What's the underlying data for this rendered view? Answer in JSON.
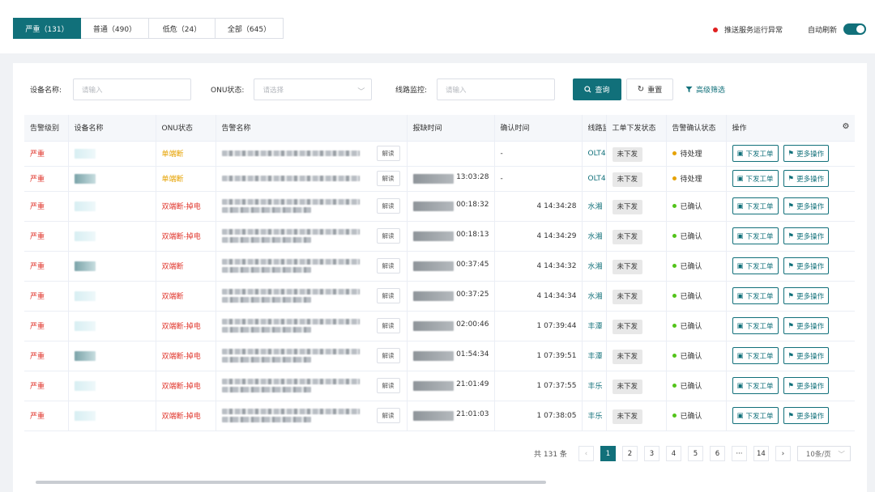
{
  "tabs": [
    {
      "label": "严重（131）",
      "active": true
    },
    {
      "label": "普通（490）",
      "active": false
    },
    {
      "label": "低危（24）",
      "active": false
    },
    {
      "label": "全部（645）",
      "active": false
    }
  ],
  "status": {
    "text": "推送服务运行异常",
    "color": "#e02020"
  },
  "auto_refresh": {
    "label": "自动刷新",
    "on": true
  },
  "filters": {
    "device_label": "设备名称:",
    "device_placeholder": "请输入",
    "onu_label": "ONU状态:",
    "onu_placeholder": "请选择",
    "line_label": "线路监控:",
    "line_placeholder": "请输入"
  },
  "buttons": {
    "search": "查询",
    "reset": "重置",
    "advanced": "高级筛选"
  },
  "table": {
    "headers": [
      "告警级别",
      "设备名称",
      "ONU状态",
      "告警名称",
      "报缺时间",
      "确认时间",
      "线路监",
      "工单下发状态",
      "告警确认状态",
      "操作"
    ],
    "read_label": "解读",
    "rows": [
      {
        "level": "严重",
        "onu": "单端断",
        "onu_type": "orange",
        "report_time": "",
        "confirm_time": "-",
        "line": "OLT4",
        "dispatch": "未下发",
        "confirm_state": "待处理",
        "state_color": "#e6a200"
      },
      {
        "level": "严重",
        "onu": "单端断",
        "onu_type": "orange",
        "report_time": "13:03:28",
        "confirm_time": "-",
        "line": "OLT4",
        "dispatch": "未下发",
        "confirm_state": "待处理",
        "state_color": "#e6a200"
      },
      {
        "level": "严重",
        "onu": "双端断-掉电",
        "onu_type": "red",
        "report_time": "00:18:32",
        "confirm_time": "4 14:34:28",
        "line": "水湘",
        "dispatch": "未下发",
        "confirm_state": "已确认",
        "state_color": "#52c41a"
      },
      {
        "level": "严重",
        "onu": "双端断-掉电",
        "onu_type": "red",
        "report_time": "00:18:13",
        "confirm_time": "4 14:34:29",
        "line": "水湘",
        "dispatch": "未下发",
        "confirm_state": "已确认",
        "state_color": "#52c41a"
      },
      {
        "level": "严重",
        "onu": "双端断",
        "onu_type": "red",
        "report_time": "00:37:45",
        "confirm_time": "4 14:34:32",
        "line": "水湘",
        "dispatch": "未下发",
        "confirm_state": "已确认",
        "state_color": "#52c41a"
      },
      {
        "level": "严重",
        "onu": "双端断",
        "onu_type": "red",
        "report_time": "00:37:25",
        "confirm_time": "4 14:34:34",
        "line": "水湘",
        "dispatch": "未下发",
        "confirm_state": "已确认",
        "state_color": "#52c41a"
      },
      {
        "level": "严重",
        "onu": "双端断-掉电",
        "onu_type": "red",
        "report_time": "02:00:46",
        "confirm_time": "1 07:39:44",
        "line": "丰潭",
        "dispatch": "未下发",
        "confirm_state": "已确认",
        "state_color": "#52c41a"
      },
      {
        "level": "严重",
        "onu": "双端断-掉电",
        "onu_type": "red",
        "report_time": "01:54:34",
        "confirm_time": "1 07:39:51",
        "line": "丰潭",
        "dispatch": "未下发",
        "confirm_state": "已确认",
        "state_color": "#52c41a"
      },
      {
        "level": "严重",
        "onu": "双端断-掉电",
        "onu_type": "red",
        "report_time": "21:01:49",
        "confirm_time": "1 07:37:55",
        "line": "丰乐",
        "dispatch": "未下发",
        "confirm_state": "已确认",
        "state_color": "#52c41a"
      },
      {
        "level": "严重",
        "onu": "双端断-掉电",
        "onu_type": "red",
        "report_time": "21:01:03",
        "confirm_time": "1 07:38:05",
        "line": "丰乐",
        "dispatch": "未下发",
        "confirm_state": "已确认",
        "state_color": "#52c41a"
      }
    ],
    "op_dispatch": "下发工单",
    "op_more": "更多操作"
  },
  "pagination": {
    "total": "共 131 条",
    "pages": [
      "1",
      "2",
      "3",
      "4",
      "5",
      "6",
      "···",
      "14"
    ],
    "current": "1",
    "page_size": "10条/页"
  },
  "colors": {
    "accent": "#11707a",
    "danger": "#e0362c",
    "warning": "#e6a200"
  }
}
